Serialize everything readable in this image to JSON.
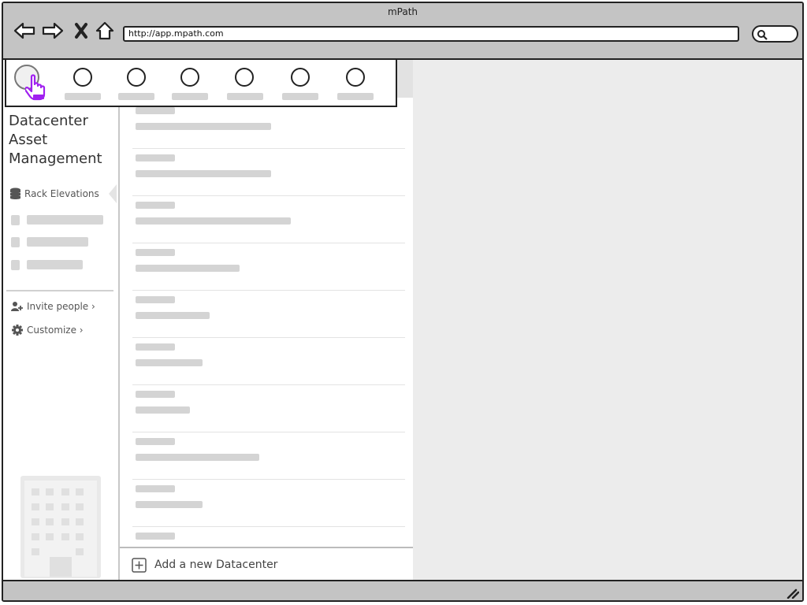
{
  "window": {
    "title": "mPath",
    "url": "http://app.mpath.com"
  },
  "browser_icons": [
    "back-arrow-icon",
    "forward-arrow-icon",
    "close-x-icon",
    "home-icon",
    "search-icon"
  ],
  "sidebar": {
    "app_title_lines": [
      "Datacenter",
      "Asset",
      "Management"
    ],
    "active_item": {
      "label": "Rack Elevations",
      "icon": "database-icon"
    },
    "placeholder_item_count": 3,
    "links": [
      {
        "label": "Invite people ›",
        "icon": "add-user-icon"
      },
      {
        "label": "Customize ›",
        "icon": "gear-icon"
      }
    ],
    "illustration": "building-icon"
  },
  "tab_bar": {
    "tab_count": 7,
    "first_tab_icon": "hand-pointer-icon",
    "accent_color": "#a020f0"
  },
  "list": {
    "footer_label": "Add a new Datacenter",
    "footer_icon": "plus-square-icon",
    "row_count": 10
  },
  "colors": {
    "chrome": "#c4c4c4",
    "placeholder": "#d4d4d4",
    "right_pane": "#ececec"
  }
}
